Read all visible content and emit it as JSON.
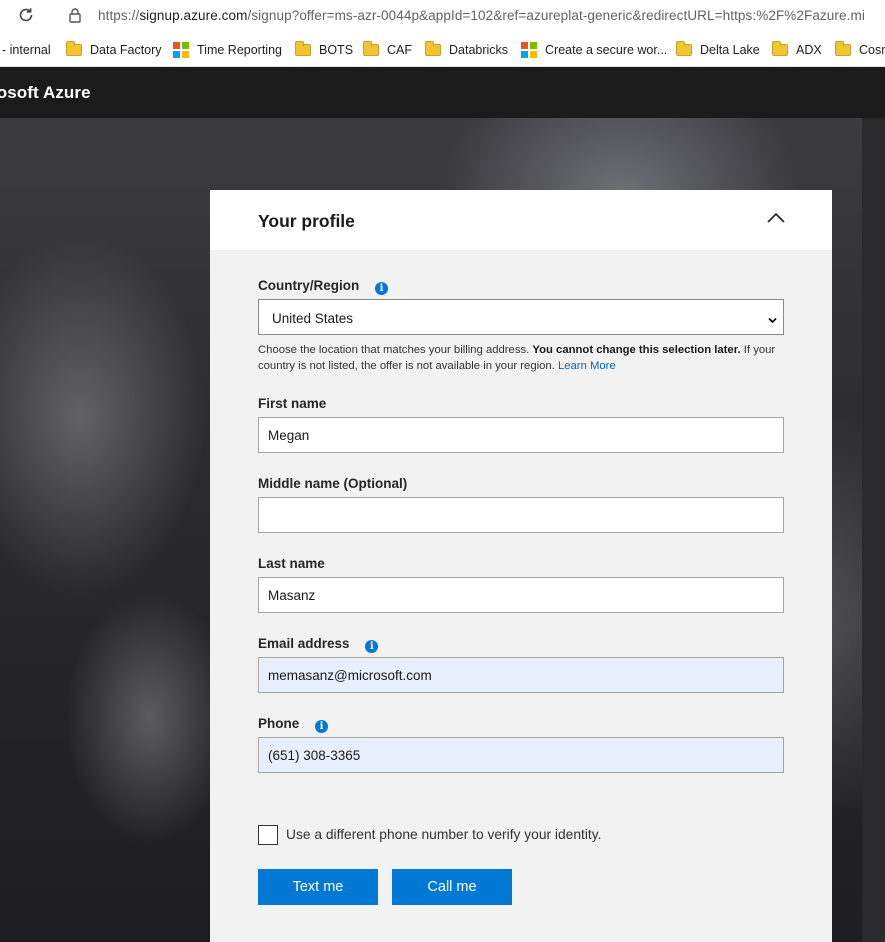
{
  "browser": {
    "url_scheme": "https://",
    "url_host": "signup.azure.com",
    "url_path": "/signup?offer=ms-azr-0044p&appId=102&ref=azureplat-generic&redirectURL=https:%2F%2Fazure.mi"
  },
  "bookmarks": [
    {
      "label": "- internal",
      "icon": "none"
    },
    {
      "label": "Data Factory",
      "icon": "folder-icon"
    },
    {
      "label": "Time Reporting",
      "icon": "microsoft-logo-icon"
    },
    {
      "label": "BOTS",
      "icon": "folder-icon"
    },
    {
      "label": "CAF",
      "icon": "folder-icon"
    },
    {
      "label": "Databricks",
      "icon": "folder-icon"
    },
    {
      "label": "Create a secure wor...",
      "icon": "microsoft-logo-icon"
    },
    {
      "label": "Delta Lake",
      "icon": "folder-icon"
    },
    {
      "label": "ADX",
      "icon": "folder-icon"
    },
    {
      "label": "Cosm",
      "icon": "folder-icon"
    }
  ],
  "header": {
    "brand": "rosoft Azure"
  },
  "card": {
    "title": "Your profile",
    "country": {
      "label": "Country/Region",
      "value": "United States",
      "help_text": "Choose the location that matches your billing address. ",
      "help_bold": "You cannot change this selection later.",
      "help_text2": " If your country is not listed, the offer is not available in your region. ",
      "learn_more": "Learn More"
    },
    "first_name": {
      "label": "First name",
      "value": "Megan"
    },
    "middle_name": {
      "label": "Middle name (Optional)",
      "value": ""
    },
    "last_name": {
      "label": "Last name",
      "value": "Masanz"
    },
    "email": {
      "label": "Email address",
      "value": "memasanz@microsoft.com"
    },
    "phone": {
      "label": "Phone",
      "value": "(651) 308-3365"
    },
    "different_phone_label": "Use a different phone number to verify your identity.",
    "text_me_label": "Text me",
    "call_me_label": "Call me"
  },
  "colors": {
    "accent": "#0078d4",
    "header_bg": "#1b1b1b",
    "card_bg": "#f2f2f2",
    "autofill_bg": "#e8f0fe"
  }
}
